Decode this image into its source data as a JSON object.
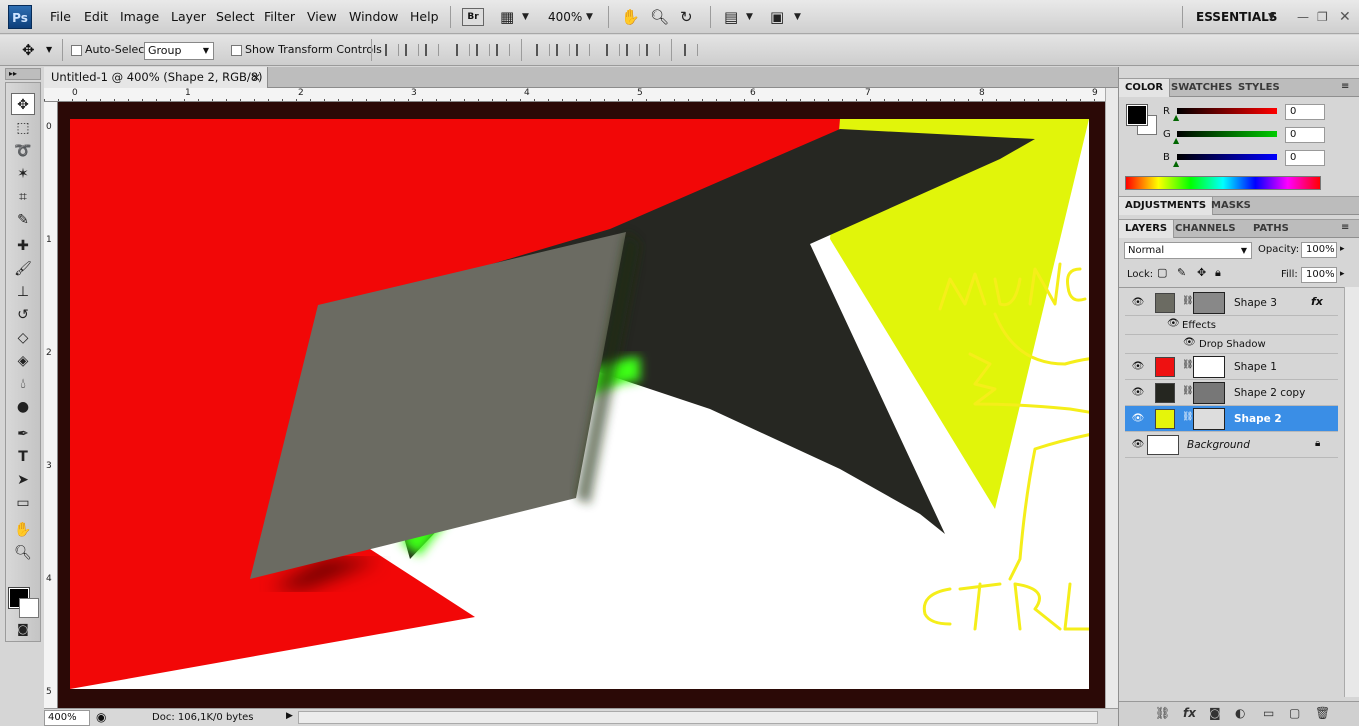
{
  "app": {
    "logo": "Ps",
    "workspace": "ESSENTIALS"
  },
  "menu": [
    "File",
    "Edit",
    "Image",
    "Layer",
    "Select",
    "Filter",
    "View",
    "Window",
    "Help"
  ],
  "appbar": {
    "bridge": "Br",
    "zoom": "400%"
  },
  "options": {
    "auto_select_label": "Auto-Select:",
    "auto_select_value": "Group",
    "show_transform_label": "Show Transform Controls"
  },
  "document": {
    "tab_title": "Untitled-1 @ 400% (Shape 2, RGB/8) *",
    "close": "×",
    "ruler_top": [
      "0",
      "1",
      "2",
      "3",
      "4",
      "5",
      "6",
      "7",
      "8",
      "9"
    ],
    "ruler_left": [
      "0",
      "1",
      "2",
      "3",
      "4",
      "5"
    ]
  },
  "status": {
    "zoom": "400%",
    "doc": "Doc: 106,1K/0 bytes"
  },
  "color_panel": {
    "tabs": [
      "COLOR",
      "SWATCHES",
      "STYLES"
    ],
    "channels": [
      {
        "label": "R",
        "value": "0",
        "color": "#ff0000"
      },
      {
        "label": "G",
        "value": "0",
        "color": "#00cc00"
      },
      {
        "label": "B",
        "value": "0",
        "color": "#0000ff"
      }
    ]
  },
  "adjust_panel": {
    "tabs": [
      "ADJUSTMENTS",
      "MASKS"
    ]
  },
  "layers_panel": {
    "tabs": [
      "LAYERS",
      "CHANNELS",
      "PATHS"
    ],
    "blend_mode": "Normal",
    "opacity_label": "Opacity:",
    "opacity": "100%",
    "lock_label": "Lock:",
    "fill_label": "Fill:",
    "fill": "100%",
    "layers": [
      {
        "name": "Shape 3",
        "color": "#6b6b62",
        "fx": "fx",
        "active": false
      },
      {
        "name": "Effects",
        "sub": true
      },
      {
        "name": "Drop Shadow",
        "sub2": true
      },
      {
        "name": "Shape 1",
        "color": "#ee1111",
        "active": false
      },
      {
        "name": "Shape 2 copy",
        "color": "#252620",
        "active": false
      },
      {
        "name": "Shape 2",
        "color": "#e5f50a",
        "active": true
      },
      {
        "name": "Background",
        "color": "#ffffff",
        "active": false
      }
    ]
  },
  "annotation": {
    "text_top": "MUNCUL",
    "text_bottom": "CTRL +",
    "color": "#f5ee1a"
  }
}
